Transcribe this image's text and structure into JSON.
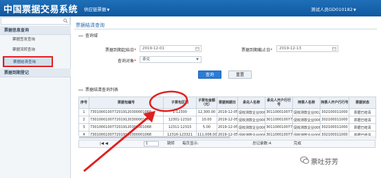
{
  "header": {
    "title": "中国票据交易系统",
    "system_menu": "供应链票据",
    "user": "测试人员GD010182"
  },
  "sidebar": {
    "search_placeholder": "",
    "groups": [
      {
        "label": "票据信息查询",
        "items": [
          "票据签发查询",
          "票据流转查询",
          "票据结清查询"
        ]
      },
      {
        "label": "票据到期登记",
        "items": []
      }
    ],
    "active_item": "票据结清查询"
  },
  "page": {
    "breadcrumb": "票据结清查询",
    "query_section": "查询域",
    "result_section": "票据结清查询列表"
  },
  "form": {
    "start_date_label": "票据到期起始日",
    "start_date": "2019-12-01",
    "end_date_label": "票据到期截止日",
    "end_date": "2019-12-13",
    "query_target_label": "查询对象",
    "query_target": "承兑",
    "query_button": "查询",
    "reset_button": "重置"
  },
  "table": {
    "columns": [
      "序号",
      "票据包编号",
      "子票包区间",
      "子票包金额（元）",
      "票据到期日",
      "承兑人名称",
      "承兑人开户行行号",
      "持票人名称",
      "持票人开户行行号",
      "票据状态"
    ],
    "rows": [
      [
        "1",
        "7301000100772019120300001068",
        "1-12300",
        "12,300.00",
        "2019-12-05",
        "促收测款企业006",
        "301100010077",
        "促收测款企业002",
        "302100011000",
        "票据已结清"
      ],
      [
        "2",
        "7301000100772019120300001068",
        "12301-12310",
        "10.00",
        "2019-12-05",
        "促收测款企业006",
        "301100010077",
        "促收测款企业006",
        "302100011000",
        "票据已结清"
      ],
      [
        "3",
        "7301000100772019120300001068",
        "12311-12315",
        "5.00",
        "2019-12-05",
        "促收测款企业006",
        "301100010077",
        "促收测款企业006",
        "302100011000",
        "票据已结清"
      ],
      [
        "4",
        "7301000100772019120300001068",
        "12316-123321",
        "111,006.00",
        "2019-12-05",
        "促收测款企业006",
        "301100010077",
        "促收测款企业006",
        "302100011000",
        "票据已结清"
      ]
    ]
  },
  "pager": {
    "nav": "|◀  ◀",
    "page_value": "1",
    "jump": "跳转",
    "page_size_label": "每页显示:",
    "total": "总记录数:4",
    "done": "完成"
  },
  "watermark": {
    "text": "票吐芬芳"
  },
  "colors": {
    "header_blue": "#1565b0",
    "primary_button": "#2b7cd6",
    "annotation_red": "#e02020"
  }
}
